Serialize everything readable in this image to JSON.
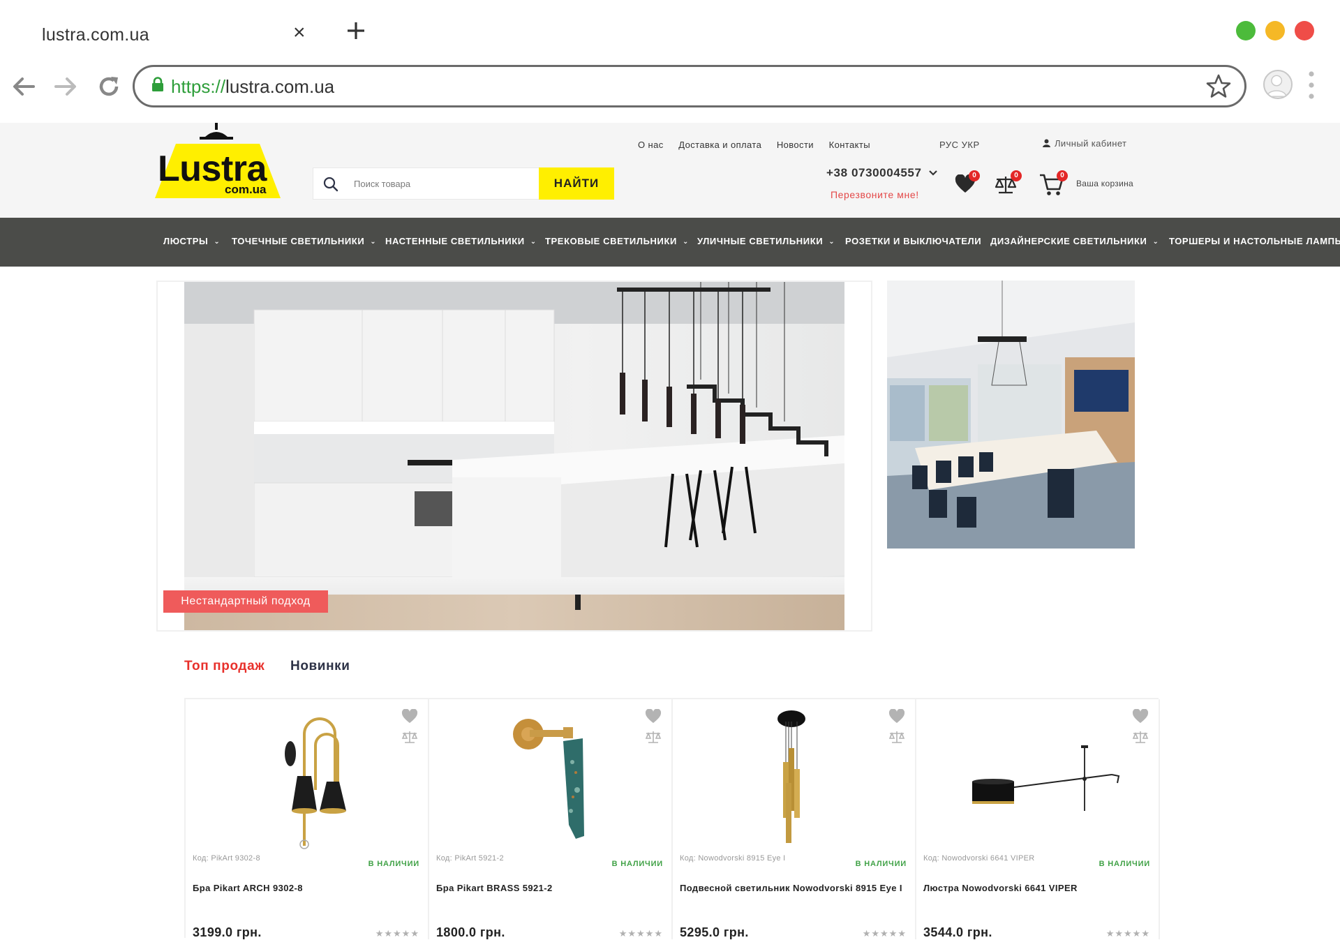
{
  "browser": {
    "tab_title": "lustra.com.ua",
    "url_scheme": "https://",
    "url_rest": "lustra.com.ua",
    "window_controls": [
      "green-dot",
      "yellow-dot",
      "red-dot"
    ]
  },
  "header": {
    "logo_text": "Lustra",
    "logo_domain": "com.ua",
    "top_links": [
      "О нас",
      "Доставка и оплата",
      "Новости",
      "Контакты"
    ],
    "lang": "РУС УКР",
    "account_label": "Личный кабинет",
    "search_placeholder": "Поиск товара",
    "search_button": "НАЙТИ",
    "phone": "+38 0730004557",
    "callback": "Перезвоните мне!",
    "wishlist_count": "0",
    "compare_count": "0",
    "cart_count": "0",
    "cart_label": "Ваша корзина"
  },
  "nav": {
    "items": [
      {
        "label": "ЛЮСТРЫ",
        "chevron": "⌄"
      },
      {
        "label": "ТОЧЕЧНЫЕ СВЕТИЛЬНИКИ",
        "chevron": "⌄"
      },
      {
        "label": "НАСТЕННЫЕ СВЕТИЛЬНИКИ",
        "chevron": "⌄"
      },
      {
        "label": "ТРЕКОВЫЕ СВЕТИЛЬНИКИ",
        "chevron": "⌄"
      },
      {
        "label": "УЛИЧНЫЕ СВЕТИЛЬНИКИ",
        "chevron": "⌄"
      },
      {
        "label": "РОЗЕТКИ И ВЫКЛЮЧАТЕЛИ",
        "chevron": ""
      },
      {
        "label": "ДИЗАЙНЕРСКИЕ СВЕТИЛЬНИКИ",
        "chevron": "⌄"
      },
      {
        "label": "ТОРШЕРЫ И НАСТОЛЬНЫЕ ЛАМПЫ",
        "chevron": ""
      }
    ]
  },
  "banner": {
    "tag": "Нестандартный подход"
  },
  "tabs": {
    "top_sales": "Топ продаж",
    "new": "Новинки"
  },
  "products": [
    {
      "code": "Код: PikArt 9302-8",
      "stock": "В НАЛИЧИИ",
      "name": "Бра Pikart ARCH 9302-8",
      "price": "3199.0 грн.",
      "stars": "★★★★★"
    },
    {
      "code": "Код: PikArt 5921-2",
      "stock": "В НАЛИЧИИ",
      "name": "Бра Pikart BRASS 5921-2",
      "price": "1800.0 грн.",
      "stars": "★★★★★"
    },
    {
      "code": "Код: Nowodvorski 8915 Eye I",
      "stock": "В НАЛИЧИИ",
      "name": "Подвесной светильник Nowodvorski 8915 Eye I",
      "price": "5295.0 грн.",
      "stars": "★★★★★"
    },
    {
      "code": "Код: Nowodvorski 6641 VIPER",
      "stock": "В НАЛИЧИИ",
      "name": "Люстра Nowodvorski 6641 VIPER",
      "price": "3544.0 грн.",
      "stars": "★★★★★"
    }
  ],
  "colors": {
    "brand_yellow": "#ffef00",
    "nav_bg": "#4b4c49",
    "accent_red": "#e34848",
    "stock_green": "#41a247",
    "tab_active": "#e8302b",
    "tab_inactive": "#2d3246"
  }
}
